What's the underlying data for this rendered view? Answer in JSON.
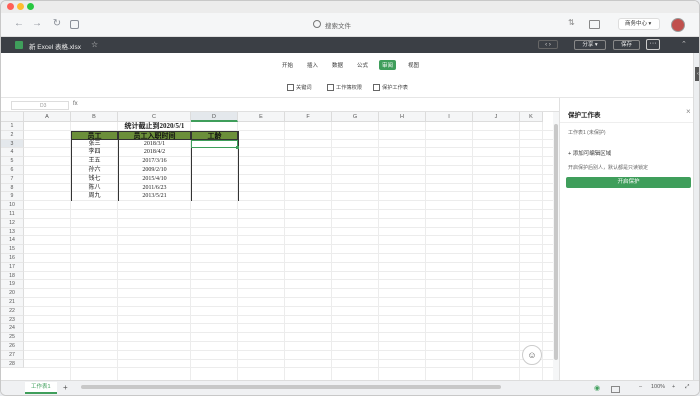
{
  "browser": {
    "search_placeholder": "搜索文件",
    "center_button": "商务中心"
  },
  "doc": {
    "title": "新 Excel 表格.xlsx",
    "share_label": "分享",
    "save_label": "保存",
    "more_label": "···"
  },
  "menu": {
    "tabs": [
      "开始",
      "插入",
      "数据",
      "公式",
      "审阅",
      "视图"
    ],
    "active_index": 4
  },
  "tools": [
    "关键词",
    "工作簿权限",
    "保护工作表"
  ],
  "formula_bar": {
    "cell_ref": "D3",
    "fx": "fx"
  },
  "grid": {
    "columns": [
      "A",
      "B",
      "C",
      "D",
      "E",
      "F",
      "G",
      "H",
      "I",
      "J",
      "K"
    ],
    "rows": [
      "1",
      "2",
      "3",
      "4",
      "5",
      "6",
      "7",
      "8",
      "9",
      "10",
      "11",
      "12",
      "13",
      "14",
      "15",
      "16",
      "17",
      "18",
      "19",
      "20",
      "21",
      "22",
      "23",
      "24",
      "25",
      "26",
      "27",
      "28"
    ],
    "selected_col": "D",
    "selected_row": "3",
    "title": "统计截止到2020/5/1",
    "headers": [
      "员工",
      "员工入职时间",
      "工龄"
    ],
    "data": [
      [
        "张三",
        "2018/3/1"
      ],
      [
        "李四",
        "2018/4/2"
      ],
      [
        "王五",
        "2017/3/16"
      ],
      [
        "孙六",
        "2009/2/10"
      ],
      [
        "钱七",
        "2015/4/10"
      ],
      [
        "陈八",
        "2011/6/23"
      ],
      [
        "周九",
        "2013/5/21"
      ]
    ]
  },
  "panel": {
    "title": "保护工作表",
    "sheet_line": "工作表1 (未保护)",
    "add_label": "+ 添加可编辑区域",
    "hint": "开启保护后别人，默认都是只读锁定",
    "button": "开启保护"
  },
  "sheetbar": {
    "tab": "工作表1",
    "add": "+",
    "zoom": "100%"
  }
}
